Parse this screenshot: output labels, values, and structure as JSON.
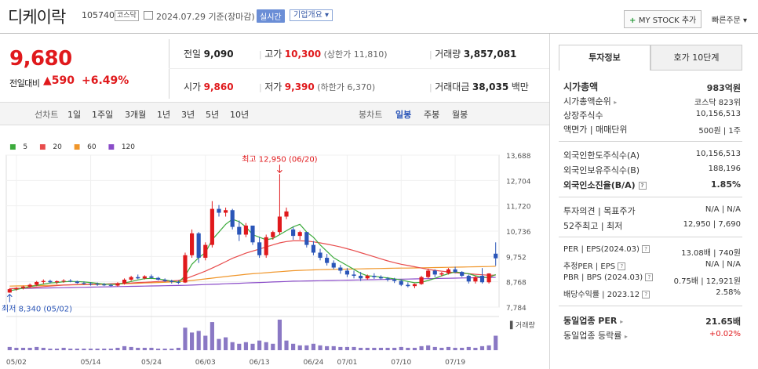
{
  "header": {
    "name": "디케이락",
    "code": "105740",
    "market": "코스닥",
    "date_text": "2024.07.29 기준(장마감)",
    "realtime_label": "실시간",
    "info_label": "기업개요 ▾",
    "mystock_label": "MY STOCK 추가",
    "quick_order_label": "빠른주문 ▾"
  },
  "quote": {
    "price": "9,680",
    "change_label": "전일대비",
    "change": "▲590",
    "change_pct": "+6.49%",
    "prev_close_label": "전일",
    "prev_close": "9,090",
    "high_label": "고가",
    "high": "10,300",
    "upper_limit": "(상한가 11,810)",
    "volume_label": "거래량",
    "volume": "3,857,081",
    "open_label": "시가",
    "open": "9,860",
    "low_label": "저가",
    "low": "9,390",
    "lower_limit": "(하한가 6,370)",
    "trade_value_label": "거래대금",
    "trade_value": "38,035",
    "trade_value_unit": "백만"
  },
  "periods": {
    "line_chart": "선차트",
    "items": [
      "1일",
      "1주일",
      "3개월",
      "1년",
      "3년",
      "5년",
      "10년"
    ],
    "candle_chart": "봉차트",
    "candle_items": [
      "일봉",
      "주봉",
      "월봉"
    ],
    "active_candle": "일봉"
  },
  "tabs": {
    "invest": "투자정보",
    "orderbook": "호가 10단계"
  },
  "invest_info": {
    "market_cap_label": "시가총액",
    "market_cap": "983억원",
    "cap_rank_label": "시가총액순위",
    "cap_rank": "코스닥 823위",
    "shares_label": "상장주식수",
    "shares": "10,156,513",
    "par_label": "액면가 | 매매단위",
    "par": "500원 | 1주",
    "foreign_limit_label": "외국인한도주식수(A)",
    "foreign_limit": "10,156,513",
    "foreign_hold_label": "외국인보유주식수(B)",
    "foreign_hold": "188,196",
    "foreign_ratio_label": "외국인소진율(B/A)",
    "foreign_ratio": "1.85%",
    "opinion_label": "투자의견 | 목표주가",
    "opinion": "N/A | N/A",
    "week52_label": "52주최고 | 최저",
    "week52": "12,950 | 7,690",
    "per_label": "PER | EPS(2024.03)",
    "per": "13.08배 | 740원",
    "est_per_label": "추정PER | EPS",
    "est_per": "N/A | N/A",
    "pbr_label": "PBR | BPS (2024.03)",
    "pbr": "0.75배 | 12,921원",
    "div_label": "배당수익률 | 2023.12",
    "div": "2.58%",
    "sector_per_label": "동일업종 PER",
    "sector_per": "21.65배",
    "sector_chg_label": "동일업종 등락률",
    "sector_chg": "+0.02%"
  },
  "colors": {
    "up": "#e0191c",
    "down": "#2a55b8",
    "ma5": "#3cab3c",
    "ma20": "#e84c4c",
    "ma60": "#f0962a",
    "ma120": "#8a4cc8"
  },
  "chart_data": {
    "type": "candlestick",
    "legend": [
      "5",
      "20",
      "60",
      "120"
    ],
    "y_ticks": [
      "13,688",
      "12,704",
      "11,720",
      "10,736",
      "9,752",
      "8,768",
      "7,784"
    ],
    "ylim": [
      7784,
      13688
    ],
    "x_ticks": [
      "05/02",
      "05/14",
      "05/24",
      "06/03",
      "06/13",
      "06/24",
      "07/01",
      "07/10",
      "07/19"
    ],
    "max_annotation": "최고 12,950 (06/20)",
    "min_annotation": "최저 8,340 (05/02)",
    "volume_label": "거래량",
    "candles": [
      [
        8350,
        8520,
        8340,
        8480
      ],
      [
        8480,
        8560,
        8420,
        8530
      ],
      [
        8530,
        8620,
        8470,
        8580
      ],
      [
        8580,
        8700,
        8540,
        8650
      ],
      [
        8650,
        8800,
        8600,
        8760
      ],
      [
        8760,
        8860,
        8690,
        8800
      ],
      [
        8800,
        8850,
        8700,
        8750
      ],
      [
        8750,
        8820,
        8680,
        8790
      ],
      [
        8790,
        8870,
        8730,
        8810
      ],
      [
        8810,
        8870,
        8750,
        8780
      ],
      [
        8780,
        8810,
        8690,
        8720
      ],
      [
        8720,
        8780,
        8650,
        8700
      ],
      [
        8700,
        8750,
        8620,
        8680
      ],
      [
        8680,
        8740,
        8610,
        8660
      ],
      [
        8660,
        8720,
        8600,
        8640
      ],
      [
        8640,
        8700,
        8580,
        8620
      ],
      [
        8620,
        8750,
        8580,
        8700
      ],
      [
        8700,
        8900,
        8660,
        8850
      ],
      [
        8850,
        9000,
        8800,
        8950
      ],
      [
        8950,
        9050,
        8870,
        8900
      ],
      [
        8900,
        9020,
        8860,
        8980
      ],
      [
        8980,
        9050,
        8900,
        8920
      ],
      [
        8920,
        8960,
        8820,
        8850
      ],
      [
        8850,
        8900,
        8760,
        8800
      ],
      [
        8800,
        8850,
        8700,
        8760
      ],
      [
        8760,
        8820,
        8680,
        8740
      ],
      [
        8740,
        9900,
        8720,
        9800
      ],
      [
        9800,
        10800,
        9700,
        10650
      ],
      [
        10650,
        10700,
        9500,
        9700
      ],
      [
        9700,
        10300,
        9600,
        10200
      ],
      [
        10200,
        11900,
        10100,
        11600
      ],
      [
        11600,
        11750,
        11300,
        11450
      ],
      [
        11450,
        11650,
        11300,
        11550
      ],
      [
        11550,
        11600,
        10800,
        10900
      ],
      [
        10900,
        11150,
        10350,
        10600
      ],
      [
        10600,
        11050,
        10500,
        10950
      ],
      [
        10950,
        10950,
        10200,
        10300
      ],
      [
        10300,
        10500,
        9700,
        9800
      ],
      [
        9800,
        10600,
        9700,
        10500
      ],
      [
        10500,
        10750,
        10400,
        10700
      ],
      [
        10700,
        12950,
        10600,
        11300
      ],
      [
        11300,
        11650,
        11200,
        11500
      ],
      [
        10800,
        10900,
        10400,
        10550
      ],
      [
        10550,
        10750,
        10400,
        10700
      ],
      [
        10700,
        10700,
        10100,
        10200
      ],
      [
        10200,
        10350,
        9800,
        9900
      ],
      [
        9900,
        10050,
        9600,
        9700
      ],
      [
        9700,
        9850,
        9400,
        9500
      ],
      [
        9500,
        9600,
        9250,
        9320
      ],
      [
        9320,
        9420,
        9080,
        9200
      ],
      [
        9200,
        9300,
        8950,
        9050
      ],
      [
        9050,
        9200,
        8900,
        9000
      ],
      [
        9000,
        9150,
        8800,
        8900
      ],
      [
        8900,
        9050,
        8850,
        9000
      ],
      [
        9000,
        9100,
        8880,
        8950
      ],
      [
        8950,
        9020,
        8850,
        8900
      ],
      [
        8900,
        8950,
        8780,
        8850
      ],
      [
        8850,
        8920,
        8720,
        8800
      ],
      [
        8800,
        8850,
        8600,
        8650
      ],
      [
        8650,
        8750,
        8550,
        8600
      ],
      [
        8600,
        8700,
        8520,
        8680
      ],
      [
        8680,
        9000,
        8650,
        8950
      ],
      [
        8950,
        9280,
        8900,
        9200
      ],
      [
        9200,
        9250,
        8950,
        9050
      ],
      [
        9050,
        9150,
        8980,
        9100
      ],
      [
        9100,
        9300,
        9050,
        9250
      ],
      [
        9250,
        9350,
        9100,
        9150
      ],
      [
        9150,
        9180,
        8950,
        9000
      ],
      [
        9000,
        9050,
        8700,
        8780
      ],
      [
        8780,
        9000,
        8700,
        8950
      ],
      [
        9000,
        9300,
        8700,
        8750
      ],
      [
        8750,
        9100,
        8700,
        9090
      ],
      [
        9860,
        10300,
        9390,
        9680
      ]
    ],
    "volumes": [
      4,
      3,
      3,
      3,
      4,
      3,
      2,
      2,
      3,
      2,
      2,
      2,
      2,
      2,
      2,
      2,
      3,
      5,
      4,
      3,
      3,
      3,
      2,
      2,
      2,
      3,
      28,
      22,
      24,
      18,
      35,
      14,
      16,
      10,
      8,
      10,
      8,
      12,
      10,
      8,
      38,
      12,
      8,
      6,
      6,
      8,
      6,
      5,
      5,
      4,
      4,
      4,
      3,
      3,
      3,
      3,
      3,
      3,
      4,
      3,
      3,
      5,
      6,
      4,
      3,
      4,
      3,
      3,
      4,
      3,
      5,
      6,
      18
    ],
    "ma5": [
      8420,
      8470,
      8520,
      8580,
      8620,
      8680,
      8720,
      8740,
      8770,
      8780,
      8780,
      8760,
      8740,
      8710,
      8680,
      8660,
      8670,
      8720,
      8780,
      8840,
      8890,
      8900,
      8880,
      8840,
      8790,
      8750,
      9000,
      9450,
      9700,
      9900,
      10400,
      10700,
      11000,
      11200,
      11100,
      10900,
      10600,
      10500,
      10400,
      10450,
      10600,
      10750,
      10900,
      11000,
      10700,
      10500,
      10200,
      9950,
      9700,
      9550,
      9400,
      9250,
      9100,
      9000,
      8980,
      8950,
      8920,
      8880,
      8840,
      8780,
      8730,
      8750,
      8820,
      8900,
      9000,
      9080,
      9150,
      9120,
      9080,
      9000,
      8950,
      8930,
      9050
    ],
    "ma20": [
      8500,
      8510,
      8520,
      8540,
      8560,
      8580,
      8600,
      8620,
      8640,
      8650,
      8660,
      8670,
      8670,
      8680,
      8680,
      8690,
      8700,
      8710,
      8720,
      8740,
      8750,
      8760,
      8780,
      8790,
      8800,
      8820,
      8880,
      8980,
      9080,
      9180,
      9300,
      9420,
      9550,
      9680,
      9780,
      9880,
      9960,
      10040,
      10120,
      10200,
      10280,
      10330,
      10360,
      10360,
      10350,
      10320,
      10280,
      10230,
      10180,
      10120,
      10050,
      9980,
      9900,
      9820,
      9740,
      9660,
      9580,
      9510,
      9450,
      9400,
      9350,
      9300,
      9250,
      9210,
      9180,
      9150,
      9120,
      9100,
      9080,
      9060,
      9040,
      9020,
      9030
    ],
    "ma60": [
      8600,
      8605,
      8610,
      8615,
      8620,
      8625,
      8630,
      8635,
      8640,
      8645,
      8650,
      8655,
      8660,
      8665,
      8670,
      8675,
      8680,
      8690,
      8700,
      8710,
      8720,
      8730,
      8740,
      8750,
      8760,
      8770,
      8790,
      8820,
      8850,
      8880,
      8910,
      8940,
      8970,
      9000,
      9030,
      9060,
      9080,
      9100,
      9120,
      9140,
      9160,
      9180,
      9200,
      9210,
      9220,
      9230,
      9240,
      9245,
      9250,
      9255,
      9260,
      9265,
      9270,
      9275,
      9280,
      9285,
      9290,
      9295,
      9300,
      9300,
      9305,
      9310,
      9315,
      9320,
      9325,
      9330,
      9335,
      9340,
      9345,
      9350,
      9355,
      9360,
      9370
    ],
    "ma120": [
      8500,
      8505,
      8510,
      8515,
      8520,
      8525,
      8530,
      8535,
      8540,
      8545,
      8550,
      8555,
      8560,
      8565,
      8570,
      8575,
      8580,
      8585,
      8590,
      8595,
      8600,
      8605,
      8610,
      8615,
      8620,
      8625,
      8630,
      8640,
      8650,
      8660,
      8670,
      8680,
      8690,
      8700,
      8710,
      8720,
      8730,
      8740,
      8750,
      8760,
      8770,
      8780,
      8790,
      8795,
      8800,
      8805,
      8810,
      8815,
      8820,
      8825,
      8830,
      8835,
      8840,
      8845,
      8850,
      8855,
      8860,
      8865,
      8870,
      8875,
      8880,
      8885,
      8890,
      8895,
      8900,
      8905,
      8910,
      8915,
      8920,
      8925,
      8930,
      8935,
      8940
    ]
  }
}
